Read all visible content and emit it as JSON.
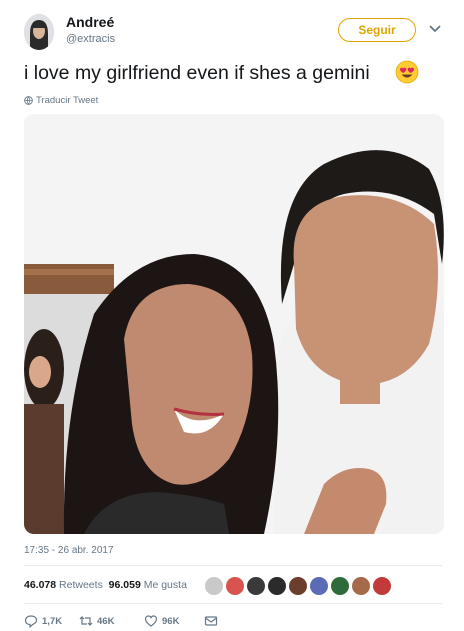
{
  "author": {
    "name": "Andreé",
    "handle": "@extracis"
  },
  "follow_label": "Seguir",
  "tweet": {
    "text": "i love my girlfriend even if shes a gemini"
  },
  "translate_label": "Traducir Tweet",
  "timestamp": "17:35 - 26 abr. 2017",
  "stats": {
    "retweets_count": "46.078",
    "retweets_label": "Retweets",
    "likes_count": "96.059",
    "likes_label": "Me gusta"
  },
  "actions": {
    "reply_count": "1,7K",
    "retweet_count": "46K",
    "like_count": "96K"
  },
  "colors": {
    "follow_accent": "#e0a400",
    "muted": "#657786",
    "text": "#14171a"
  },
  "likers": [
    {
      "color": "#c9c9c9"
    },
    {
      "color": "#d9534f"
    },
    {
      "color": "#3a3a3a"
    },
    {
      "color": "#2b2b2b"
    },
    {
      "color": "#6b3e2e"
    },
    {
      "color": "#5b6bb5"
    },
    {
      "color": "#2f6b3a"
    },
    {
      "color": "#a56a4a"
    },
    {
      "color": "#c23b3b"
    }
  ]
}
